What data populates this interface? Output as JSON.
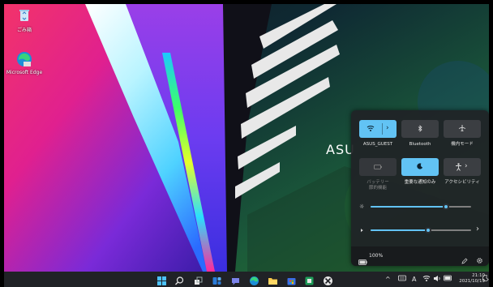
{
  "desktop": {
    "icons": [
      {
        "label": "ごみ箱",
        "icon": "recycle-bin-icon"
      },
      {
        "label": "Microsoft Edge",
        "icon": "edge-icon"
      }
    ],
    "wallpaper_brand_text": "ASU"
  },
  "quick_settings": {
    "tiles": [
      {
        "label": "ASUS_GUEST",
        "icon": "wifi-icon",
        "active": true,
        "has_arrow": true,
        "disabled": false
      },
      {
        "label": "Bluetooth",
        "icon": "bluetooth-icon",
        "active": false,
        "has_arrow": false,
        "disabled": false
      },
      {
        "label": "機内モード",
        "icon": "airplane-icon",
        "active": false,
        "has_arrow": false,
        "disabled": false
      },
      {
        "label": "バッテリー\n節約機能",
        "icon": "battery-saver-icon",
        "active": false,
        "has_arrow": false,
        "disabled": true
      },
      {
        "label": "重要な通知のみ",
        "icon": "moon-icon",
        "active": true,
        "has_arrow": false,
        "disabled": false
      },
      {
        "label": "アクセシビリティ",
        "icon": "accessibility-icon",
        "active": false,
        "has_arrow": true,
        "disabled": false
      }
    ],
    "brightness": {
      "icon": "sun-icon",
      "level_percent": 75
    },
    "volume": {
      "icon": "speaker-icon",
      "level_percent": 57
    },
    "battery_text": "100%",
    "accent_color": "#62c3f4"
  },
  "taskbar": {
    "apps": [
      "start-icon",
      "search-icon",
      "task-view-icon",
      "widgets-icon",
      "chat-icon",
      "edge-icon",
      "file-explorer-icon",
      "store-icon",
      "app-icon",
      "xbox-icon"
    ],
    "tray": {
      "ime": "A",
      "time": "21:10",
      "date": "2021/10/19"
    }
  }
}
